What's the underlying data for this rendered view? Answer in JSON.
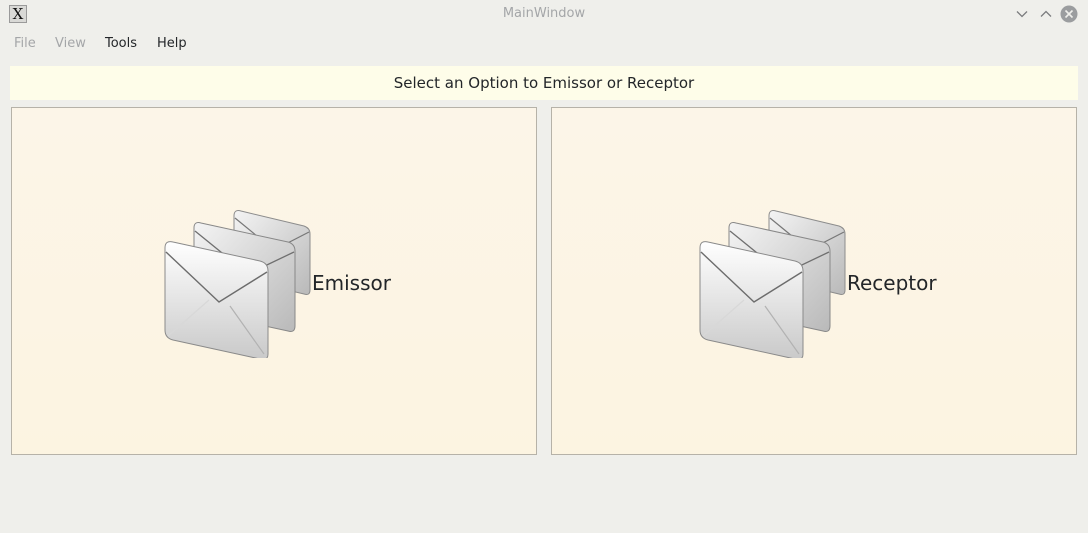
{
  "window": {
    "title": "MainWindow",
    "app_icon_glyph": "X",
    "controls": [
      "chevron-down-icon",
      "chevron-up-icon",
      "close-icon"
    ]
  },
  "menubar": {
    "items": [
      {
        "label": "File",
        "enabled": false
      },
      {
        "label": "View",
        "enabled": false
      },
      {
        "label": "Tools",
        "enabled": true
      },
      {
        "label": "Help",
        "enabled": true
      }
    ]
  },
  "banner": {
    "text": "Select an Option to Emissor or Receptor"
  },
  "options": [
    {
      "label": "Emissor",
      "icon": "envelopes-icon"
    },
    {
      "label": "Receptor",
      "icon": "envelopes-icon"
    }
  ],
  "colors": {
    "window_bg": "#efefeb",
    "banner_bg": "#fefde9",
    "button_bg": "#fcf5e8",
    "disabled_text": "#a4a6a8"
  }
}
